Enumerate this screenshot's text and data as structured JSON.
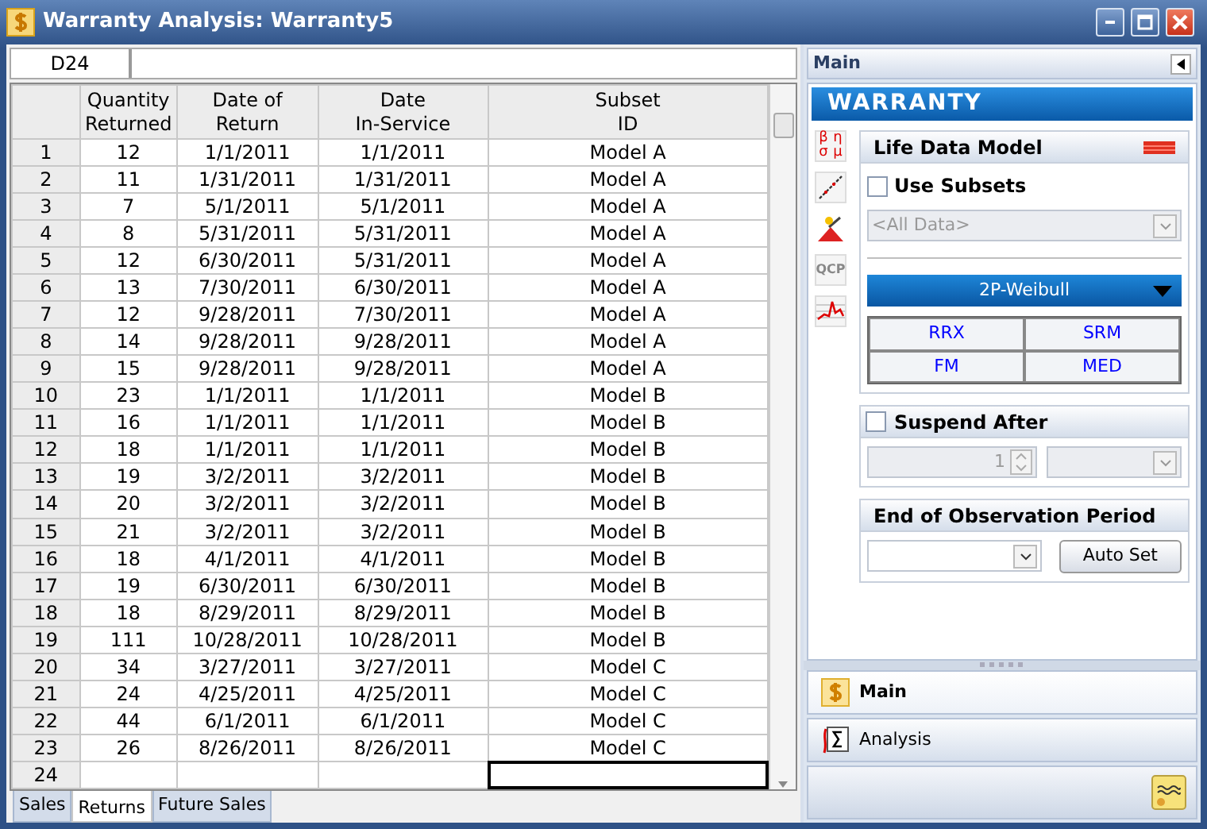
{
  "window": {
    "title": "Warranty Analysis: Warranty5"
  },
  "cell_reference": "D24",
  "table": {
    "columns": [
      "Quantity\nReturned",
      "Date of\nReturn",
      "Date\nIn-Service",
      "Subset\nID"
    ],
    "rows": [
      {
        "number": "1",
        "cells": [
          "12",
          "1/1/2011",
          "1/1/2011",
          "Model A"
        ],
        "selected": false
      },
      {
        "number": "2",
        "cells": [
          "11",
          "1/31/2011",
          "1/31/2011",
          "Model A"
        ],
        "selected": false
      },
      {
        "number": "3",
        "cells": [
          "7",
          "5/1/2011",
          "5/1/2011",
          "Model A"
        ],
        "selected": false
      },
      {
        "number": "4",
        "cells": [
          "8",
          "5/31/2011",
          "5/31/2011",
          "Model A"
        ],
        "selected": false
      },
      {
        "number": "5",
        "cells": [
          "12",
          "6/30/2011",
          "5/31/2011",
          "Model A"
        ],
        "selected": false
      },
      {
        "number": "6",
        "cells": [
          "13",
          "7/30/2011",
          "6/30/2011",
          "Model A"
        ],
        "selected": false
      },
      {
        "number": "7",
        "cells": [
          "12",
          "9/28/2011",
          "7/30/2011",
          "Model A"
        ],
        "selected": false
      },
      {
        "number": "8",
        "cells": [
          "14",
          "9/28/2011",
          "9/28/2011",
          "Model A"
        ],
        "selected": false
      },
      {
        "number": "9",
        "cells": [
          "15",
          "9/28/2011",
          "9/28/2011",
          "Model A"
        ],
        "selected": false
      },
      {
        "number": "10",
        "cells": [
          "23",
          "1/1/2011",
          "1/1/2011",
          "Model B"
        ],
        "selected": false
      },
      {
        "number": "11",
        "cells": [
          "16",
          "1/1/2011",
          "1/1/2011",
          "Model B"
        ],
        "selected": false
      },
      {
        "number": "12",
        "cells": [
          "18",
          "1/1/2011",
          "1/1/2011",
          "Model B"
        ],
        "selected": false
      },
      {
        "number": "13",
        "cells": [
          "19",
          "3/2/2011",
          "3/2/2011",
          "Model B"
        ],
        "selected": false
      },
      {
        "number": "14",
        "cells": [
          "20",
          "3/2/2011",
          "3/2/2011",
          "Model B"
        ],
        "selected": false
      },
      {
        "number": "15",
        "cells": [
          "21",
          "3/2/2011",
          "3/2/2011",
          "Model B"
        ],
        "selected": false
      },
      {
        "number": "16",
        "cells": [
          "18",
          "4/1/2011",
          "4/1/2011",
          "Model B"
        ],
        "selected": false
      },
      {
        "number": "17",
        "cells": [
          "19",
          "6/30/2011",
          "6/30/2011",
          "Model B"
        ],
        "selected": false
      },
      {
        "number": "18",
        "cells": [
          "18",
          "8/29/2011",
          "8/29/2011",
          "Model B"
        ],
        "selected": false
      },
      {
        "number": "19",
        "cells": [
          "111",
          "10/28/2011",
          "10/28/2011",
          "Model B"
        ],
        "selected": false
      },
      {
        "number": "20",
        "cells": [
          "34",
          "3/27/2011",
          "3/27/2011",
          "Model C"
        ],
        "selected": false
      },
      {
        "number": "21",
        "cells": [
          "24",
          "4/25/2011",
          "4/25/2011",
          "Model C"
        ],
        "selected": false
      },
      {
        "number": "22",
        "cells": [
          "44",
          "6/1/2011",
          "6/1/2011",
          "Model C"
        ],
        "selected": false
      },
      {
        "number": "23",
        "cells": [
          "26",
          "8/26/2011",
          "8/26/2011",
          "Model C"
        ],
        "selected": false
      },
      {
        "number": "24",
        "cells": [
          "",
          "",
          "",
          ""
        ],
        "selected": true
      }
    ]
  },
  "sheet_tabs": [
    {
      "label": "Sales",
      "selected": false
    },
    {
      "label": "Returns",
      "selected": true
    },
    {
      "label": "Future Sales",
      "selected": false
    }
  ],
  "panel": {
    "title": "Main",
    "banner": "WARRANTY",
    "tools": [
      {
        "kind": "params",
        "glyphs": [
          "β",
          "η",
          "σ",
          "μ"
        ]
      },
      {
        "kind": "plot"
      },
      {
        "kind": "wizard"
      },
      {
        "kind": "qcp",
        "label": "QCP"
      },
      {
        "kind": "chart"
      }
    ],
    "life_data_model": {
      "title": "Life Data Model",
      "use_subsets": {
        "label": "Use Subsets",
        "checked": false
      },
      "subset": {
        "value": "<All Data>",
        "disabled": true
      },
      "distribution": "2P-Weibull",
      "methods": [
        "RRX",
        "SRM",
        "FM",
        "MED"
      ]
    },
    "suspend_after": {
      "label": "Suspend After",
      "checked": false,
      "value": "1",
      "disabled": true
    },
    "end_of_observation": {
      "title": "End of Observation Period",
      "button": "Auto Set"
    },
    "navigation": [
      {
        "label": "Main",
        "kind": "main",
        "selected": true
      },
      {
        "label": "Analysis",
        "kind": "analysis",
        "selected": false
      }
    ]
  }
}
